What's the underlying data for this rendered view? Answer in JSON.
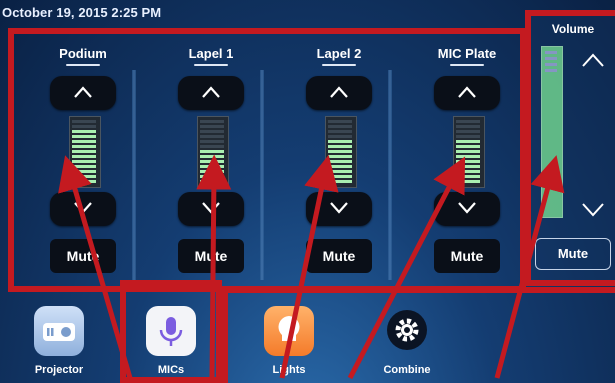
{
  "status": {
    "datetime": "October 19, 2015 2:25 PM"
  },
  "channels": [
    {
      "name": "Podium",
      "mute_label": "Mute",
      "level_segments_on": 11
    },
    {
      "name": "Lapel 1",
      "mute_label": "Mute",
      "level_segments_on": 7
    },
    {
      "name": "Lapel 2",
      "mute_label": "Mute",
      "level_segments_on": 9
    },
    {
      "name": "MIC Plate",
      "mute_label": "Mute",
      "level_segments_on": 9
    }
  ],
  "volume": {
    "title": "Volume",
    "mute_label": "Mute"
  },
  "nav": [
    {
      "label": "Projector",
      "icon": "projector-icon"
    },
    {
      "label": "MICs",
      "icon": "microphone-icon"
    },
    {
      "label": "Lights",
      "icon": "light-bulb-icon"
    },
    {
      "label": "Combine",
      "icon": "gear-icon"
    }
  ],
  "colors": {
    "annotation_red": "#c41a20",
    "meter_on": "#a9efb0",
    "button_bg": "#0a0f18"
  }
}
